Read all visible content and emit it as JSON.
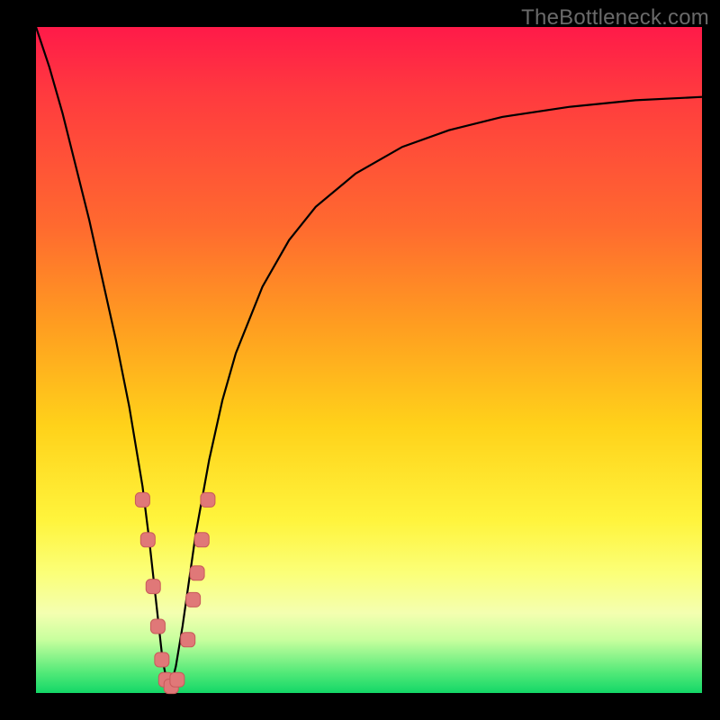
{
  "watermark": "TheBottleneck.com",
  "colors": {
    "frame": "#000000",
    "curve": "#000000",
    "marker_fill": "#e07878",
    "marker_stroke": "#c85a5a",
    "gradient_stops": [
      "#ff1a49",
      "#ff6a2f",
      "#ffd21a",
      "#fbff78",
      "#51e978",
      "#13d767"
    ]
  },
  "chart_data": {
    "type": "line",
    "title": "",
    "xlabel": "",
    "ylabel": "",
    "xlim": [
      0,
      100
    ],
    "ylim": [
      0,
      100
    ],
    "note": "x is a normalized component-score axis (0=left edge, 100=right edge); y is bottleneck percentage (0=bottom/green/no bottleneck, 100=top/red/full bottleneck). Curve has a sharp minimum near x≈20 (balanced point).",
    "x": [
      0,
      2,
      4,
      6,
      8,
      10,
      12,
      14,
      16,
      17,
      18,
      19,
      20,
      21,
      22,
      23,
      24,
      26,
      28,
      30,
      34,
      38,
      42,
      48,
      55,
      62,
      70,
      80,
      90,
      100
    ],
    "y": [
      100,
      94,
      87,
      79,
      71,
      62,
      53,
      43,
      31,
      23,
      14,
      5,
      0,
      4,
      10,
      17,
      24,
      35,
      44,
      51,
      61,
      68,
      73,
      78,
      82,
      84.5,
      86.5,
      88,
      89,
      89.5
    ],
    "markers": {
      "note": "highlighted sample points near the minimum, shown as rounded pink squares",
      "points": [
        {
          "x": 16.0,
          "y": 29
        },
        {
          "x": 16.8,
          "y": 23
        },
        {
          "x": 17.6,
          "y": 16
        },
        {
          "x": 18.3,
          "y": 10
        },
        {
          "x": 18.9,
          "y": 5
        },
        {
          "x": 19.5,
          "y": 2
        },
        {
          "x": 20.3,
          "y": 1
        },
        {
          "x": 21.2,
          "y": 2
        },
        {
          "x": 22.8,
          "y": 8
        },
        {
          "x": 23.6,
          "y": 14
        },
        {
          "x": 24.2,
          "y": 18
        },
        {
          "x": 24.9,
          "y": 23
        },
        {
          "x": 25.8,
          "y": 29
        }
      ]
    }
  }
}
